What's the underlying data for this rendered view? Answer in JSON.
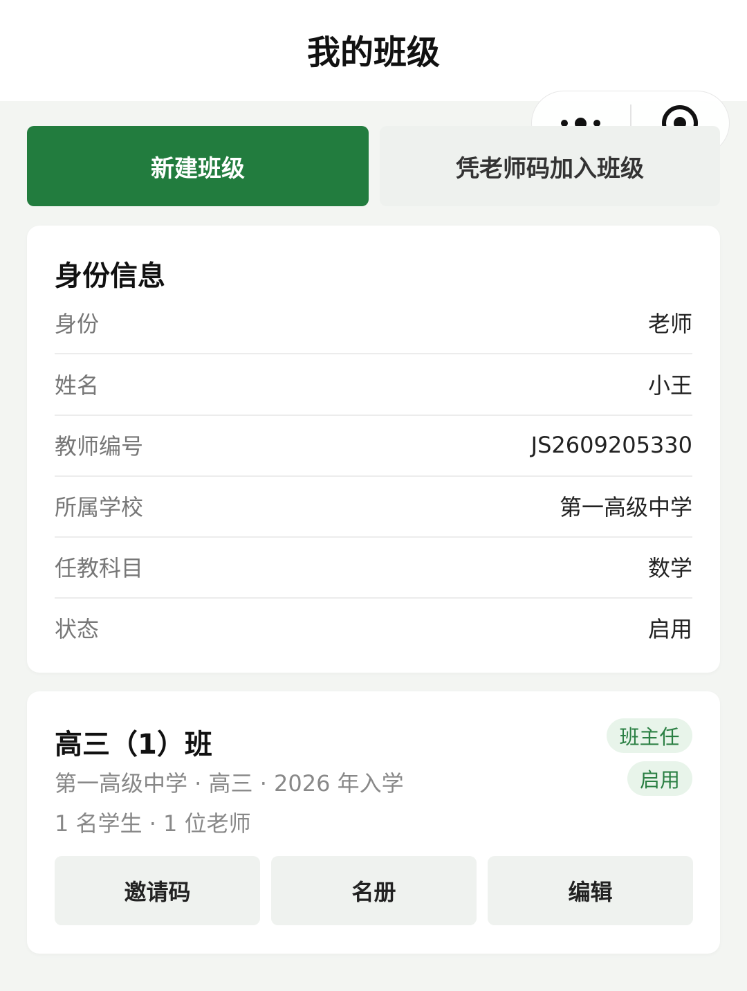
{
  "header": {
    "title": "我的班级"
  },
  "capsule": {
    "more_icon": "more-dots-icon",
    "close_icon": "target-circle-icon"
  },
  "actions": {
    "new_class": "新建班级",
    "join_class": "凭老师码加入班级"
  },
  "identity": {
    "title": "身份信息",
    "rows": [
      {
        "label": "身份",
        "value": "老师"
      },
      {
        "label": "姓名",
        "value": "小王"
      },
      {
        "label": "教师编号",
        "value": "JS2609205330"
      },
      {
        "label": "所属学校",
        "value": "第一高级中学"
      },
      {
        "label": "任教科目",
        "value": "数学"
      },
      {
        "label": "状态",
        "value": "启用"
      }
    ]
  },
  "class_card": {
    "name": "高三（1）班",
    "meta": "第一高级中学 · 高三 · 2026 年入学",
    "counts": "1 名学生 · 1 位老师",
    "badge_role": "班主任",
    "badge_status": "启用",
    "buttons": {
      "invite": "邀请码",
      "roster": "名册",
      "edit": "编辑"
    }
  },
  "colors": {
    "primary": "#227c3e",
    "badge_bg": "#e8f4ea",
    "badge_text": "#2a7f43",
    "page_bg": "#f3f5f2"
  }
}
